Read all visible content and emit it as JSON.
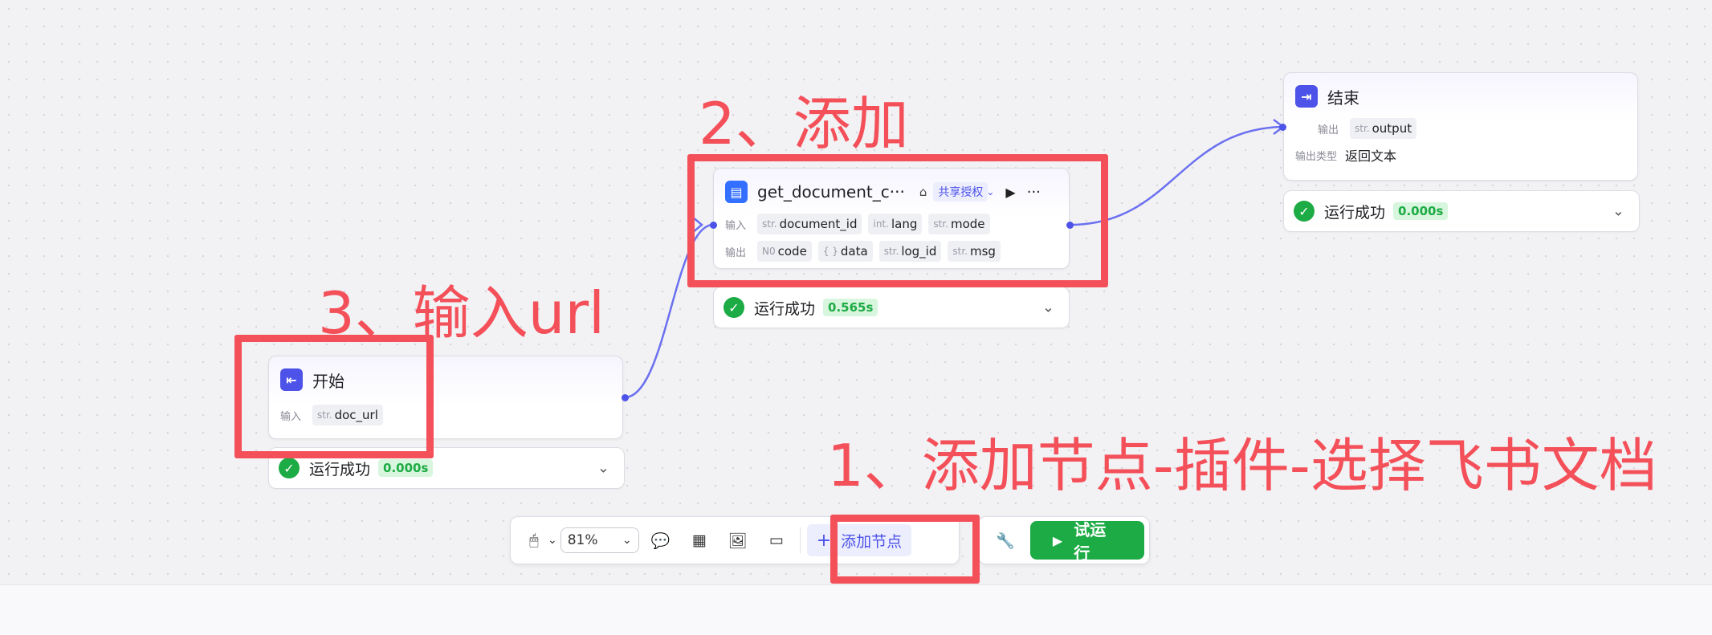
{
  "nodes": {
    "start": {
      "title": "开始",
      "input_label": "输入",
      "input_type": "str.",
      "input_name": "doc_url",
      "status": "运行成功",
      "time": "0.000s"
    },
    "plugin": {
      "title": "get_document_c···",
      "auth_badge": "共享授权",
      "input_label": "输入",
      "output_label": "输出",
      "inputs": [
        {
          "type": "str.",
          "name": "document_id"
        },
        {
          "type": "int.",
          "name": "lang"
        },
        {
          "type": "str.",
          "name": "mode"
        }
      ],
      "outputs": [
        {
          "type": "N0",
          "name": "code"
        },
        {
          "type": "{ }",
          "name": "data"
        },
        {
          "type": "str.",
          "name": "log_id"
        },
        {
          "type": "str.",
          "name": "msg"
        }
      ],
      "status": "运行成功",
      "time": "0.565s"
    },
    "end": {
      "title": "结束",
      "output_label": "输出",
      "output_type": "str.",
      "output_name": "output",
      "output_kind_label": "输出类型",
      "output_kind_value": "返回文本",
      "status": "运行成功",
      "time": "0.000s"
    }
  },
  "annotations": {
    "step1": "1、添加节点-插件-选择飞书文档",
    "step2": "2、添加",
    "step3": "3、输入url"
  },
  "toolbar": {
    "zoom": "81%",
    "add_node": "添加节点",
    "run": "试运行"
  },
  "colors": {
    "accent": "#4d53e8",
    "success": "#1cab44",
    "annotation": "#f4505a"
  }
}
